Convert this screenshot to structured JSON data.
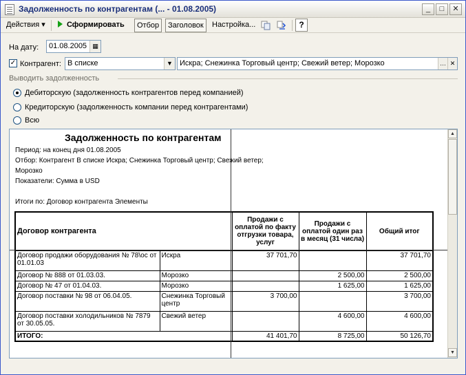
{
  "window": {
    "title": "Задолженность по контрагентам (... - 01.08.2005)",
    "controls": {
      "minimize": "_",
      "maximize": "□",
      "close": "✕"
    }
  },
  "toolbar": {
    "actions_label": "Действия ▾",
    "generate_label": "Сформировать",
    "filter_label": "Отбор",
    "header_label": "Заголовок",
    "settings_label": "Настройка...",
    "help_label": "?"
  },
  "form": {
    "date_label": "На дату:",
    "date_value": "01.08.2005",
    "counterparty_label": "Контрагент:",
    "counterparty_checked": true,
    "counterparty_mode": "В списке",
    "counterparty_value": "Искра; Снежинка Торговый центр; Свежий ветер; Морозко",
    "output_section_title": "Выводить задолженность",
    "radio_options": [
      {
        "label": "Дебиторскую (задолженность контрагентов перед компанией)",
        "selected": true
      },
      {
        "label": "Кредиторскую (задолженность компании перед контрагентами)",
        "selected": false
      },
      {
        "label": "Всю",
        "selected": false
      }
    ]
  },
  "report": {
    "title": "Задолженность по контрагентам",
    "period": "Период: на конец дня 01.08.2005",
    "filter_line1": "Отбор: Контрагент В списке Искра; Снежинка Торговый центр; Свежий ветер;",
    "filter_line2": "Морозко",
    "indicators": "Показатели: Сумма в USD",
    "totals_by": "Итоги по: Договор контрагента Элементы",
    "columns": {
      "contract": "Договор контрагента",
      "col1": "Продажи с оплатой по факту отгрузки товара, услуг",
      "col2": "Продажи с оплатой один раз в месяц (31 числа)",
      "total": "Общий итог"
    },
    "rows": [
      {
        "contract": "Договор продажи оборудования № 78\\ос от 01.01.03",
        "counterparty": "Искра",
        "col1": "37 701,70",
        "col2": "",
        "total": "37 701,70"
      },
      {
        "contract": "Договор № 888 от 01.03.03.",
        "counterparty": "Морозко",
        "col1": "",
        "col2": "2 500,00",
        "total": "2 500,00"
      },
      {
        "contract": "Договор № 47 от 01.04.03.",
        "counterparty": "Морозко",
        "col1": "",
        "col2": "1 625,00",
        "total": "1 625,00"
      },
      {
        "contract": "Договор поставки № 98 от 06.04.05.",
        "counterparty": "Снежинка Торговый центр",
        "col1": "3 700,00",
        "col2": "",
        "total": "3 700,00"
      },
      {
        "contract": "Договор поставки холодильников № 7879 от 30.05.05.",
        "counterparty": "Свежий ветер",
        "col1": "",
        "col2": "4 600,00",
        "total": "4 600,00"
      }
    ],
    "total_row": {
      "label": "ИТОГО:",
      "col1": "41 401,70",
      "col2": "8 725,00",
      "total": "50 126,70"
    }
  }
}
